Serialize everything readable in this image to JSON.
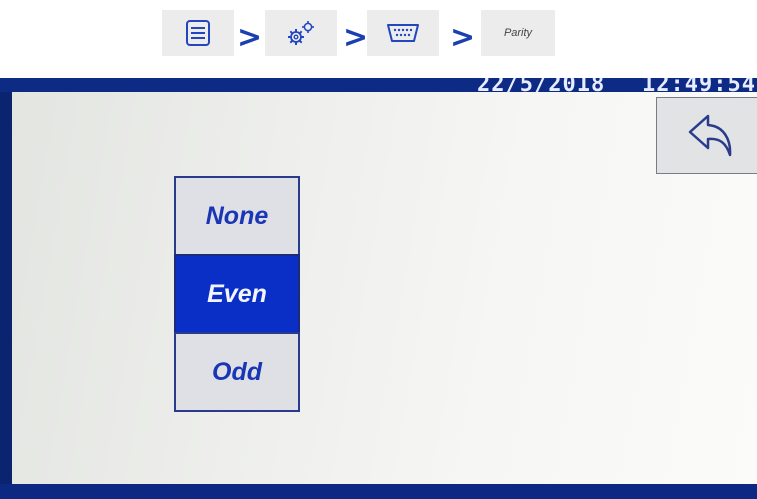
{
  "breadcrumb": {
    "items": [
      {
        "icon": "menu-list-icon"
      },
      {
        "icon": "gears-icon"
      },
      {
        "icon": "serial-port-icon"
      },
      {
        "label": "Parity"
      }
    ],
    "separator": ">"
  },
  "status": {
    "date": "22/5/2018",
    "time": "12:49:54"
  },
  "back_button": {
    "icon": "back-arrow-icon"
  },
  "parity": {
    "options": [
      {
        "label": "None",
        "selected": false
      },
      {
        "label": "Even",
        "selected": true
      },
      {
        "label": "Odd",
        "selected": false
      }
    ]
  },
  "colors": {
    "accent_blue": "#0a2fc6",
    "frame_blue": "#0b2470",
    "text_blue": "#1a36b5"
  }
}
